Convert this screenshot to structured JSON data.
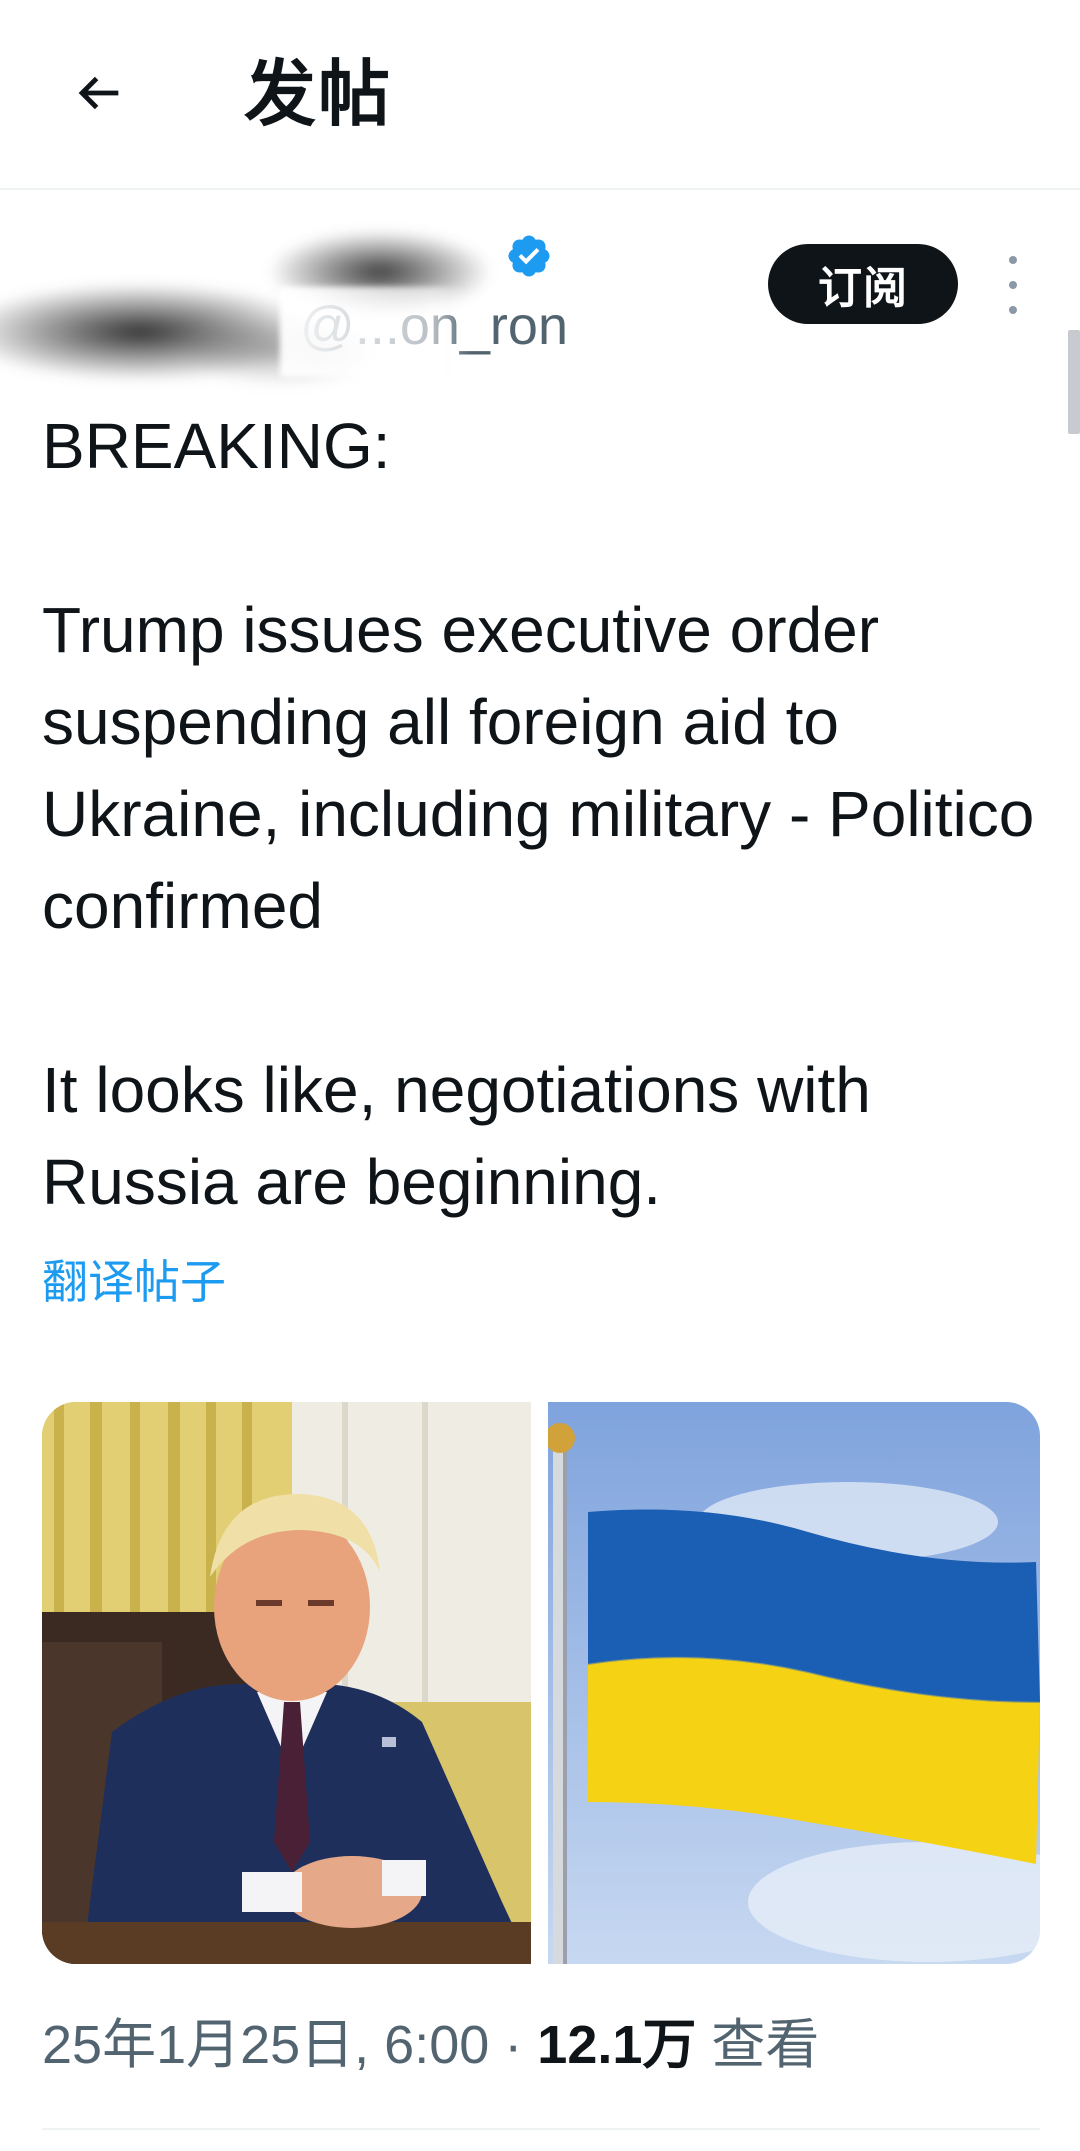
{
  "header": {
    "title": "发帖"
  },
  "author": {
    "handle": "@...on_ron",
    "subscribe_label": "订阅",
    "colors": {
      "verified": "#1d9bf0"
    }
  },
  "post": {
    "lines": [
      "BREAKING:",
      "Trump issues executive order suspending all foreign aid to Ukraine, including military - Politico confirmed",
      "It looks like, negotiations with Russia are beginning."
    ],
    "translate_label": "翻译帖子"
  },
  "media": {
    "images": [
      "president-at-desk-photo",
      "ukraine-flag-photo"
    ]
  },
  "meta": {
    "timestamp": "25年1月25日, 6:00",
    "separator": "·",
    "views_count": "12.1万",
    "views_label": "查看"
  }
}
